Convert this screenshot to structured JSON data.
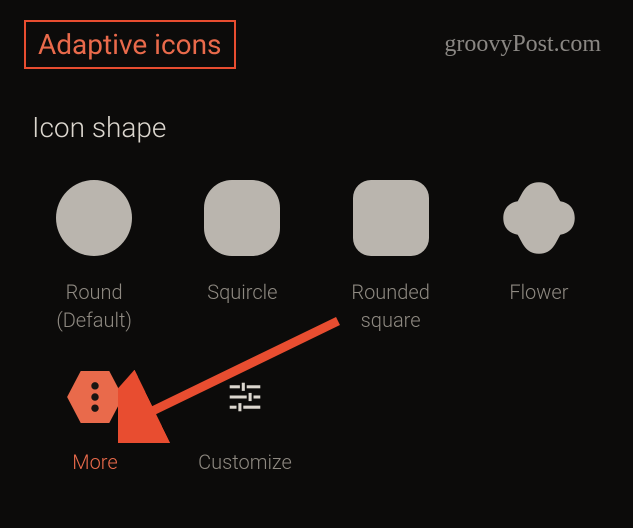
{
  "header": {
    "title": "Adaptive icons",
    "watermark": "groovyPost.com"
  },
  "section": {
    "title": "Icon shape"
  },
  "shapes": [
    {
      "id": "round",
      "label_line1": "Round",
      "label_line2": "(Default)"
    },
    {
      "id": "squircle",
      "label_line1": "Squircle",
      "label_line2": ""
    },
    {
      "id": "rounded-square",
      "label_line1": "Rounded",
      "label_line2": "square"
    },
    {
      "id": "flower",
      "label_line1": "Flower",
      "label_line2": ""
    }
  ],
  "actions": {
    "more": {
      "label": "More"
    },
    "customize": {
      "label": "Customize"
    }
  },
  "colors": {
    "accent": "#e96a4b",
    "highlight_border": "#e84d30",
    "shape_fill": "#bab5ae",
    "text_muted": "#8f8a82"
  }
}
